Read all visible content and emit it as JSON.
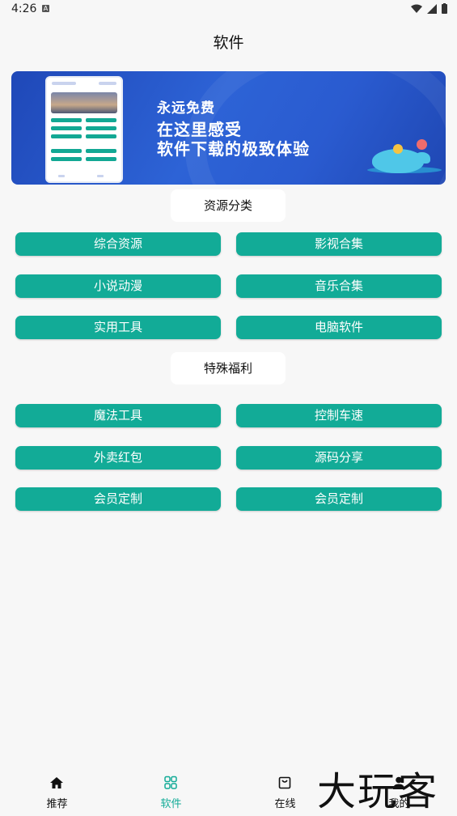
{
  "status": {
    "time": "4:26",
    "a_badge": "A"
  },
  "header": {
    "title": "软件"
  },
  "banner": {
    "line1": "永远免费",
    "line2": "在这里感受",
    "line3": "软件下载的极致体验"
  },
  "sections": [
    {
      "label": "资源分类",
      "buttons": [
        "综合资源",
        "影视合集",
        "小说动漫",
        "音乐合集",
        "实用工具",
        "电脑软件"
      ]
    },
    {
      "label": "特殊福利",
      "buttons": [
        "魔法工具",
        "控制车速",
        "外卖红包",
        "源码分享",
        "会员定制",
        "会员定制"
      ]
    }
  ],
  "bottom_nav": [
    {
      "label": "推荐",
      "icon": "home-icon"
    },
    {
      "label": "软件",
      "icon": "grid-icon",
      "active": true
    },
    {
      "label": "在线",
      "icon": "bag-icon"
    },
    {
      "label": "我的",
      "icon": "person-icon"
    }
  ],
  "watermark": "大玩客",
  "colors": {
    "accent": "#12ab97",
    "banner": "#2d63d6",
    "background": "#f7f7f7"
  }
}
